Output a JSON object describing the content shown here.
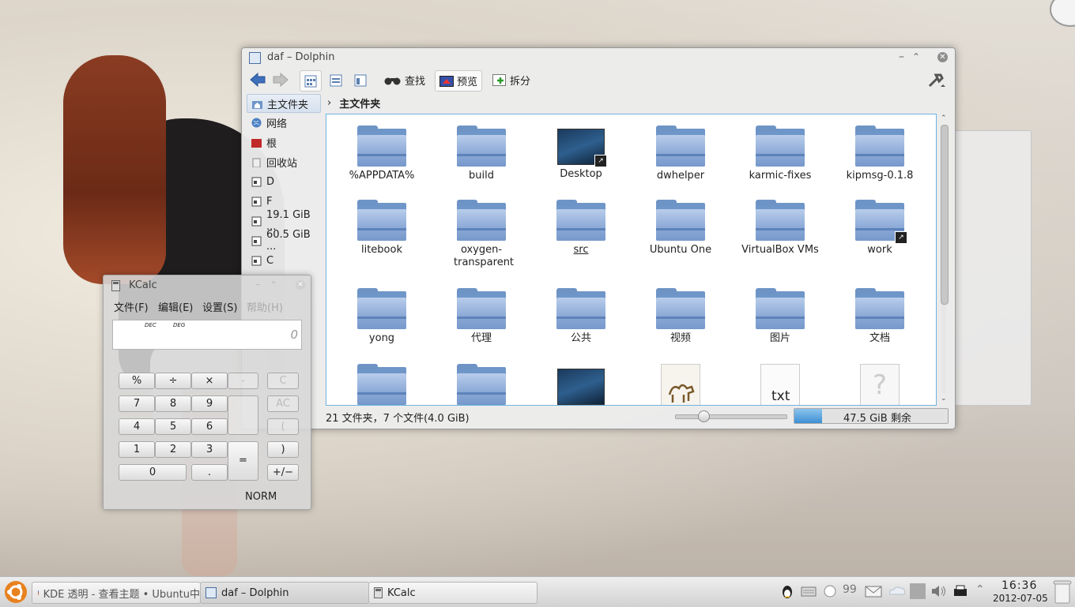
{
  "dolphin": {
    "title": "daf – Dolphin",
    "toolbar": {
      "find": "查找",
      "preview": "预览",
      "split": "拆分"
    },
    "places": [
      "主文件夹",
      "网络",
      "根",
      "回收站",
      "D",
      "F",
      "19.1 GiB ...",
      "60.5 GiB ...",
      "C"
    ],
    "breadcrumb": "主文件夹",
    "items": [
      {
        "label": "%APPDATA%",
        "kind": "folder"
      },
      {
        "label": "build",
        "kind": "folder"
      },
      {
        "label": "Desktop",
        "kind": "desktop-link"
      },
      {
        "label": "dwhelper",
        "kind": "folder"
      },
      {
        "label": "karmic-fixes",
        "kind": "folder"
      },
      {
        "label": "kipmsg-0.1.8",
        "kind": "folder"
      },
      {
        "label": "litebook",
        "kind": "folder"
      },
      {
        "label": "oxygen-transparent",
        "kind": "folder"
      },
      {
        "label": "src",
        "kind": "folder"
      },
      {
        "label": "Ubuntu One",
        "kind": "folder"
      },
      {
        "label": "VirtualBox VMs",
        "kind": "folder"
      },
      {
        "label": "work",
        "kind": "folder-link"
      },
      {
        "label": "yong",
        "kind": "folder"
      },
      {
        "label": "代理",
        "kind": "folder"
      },
      {
        "label": "公共",
        "kind": "folder"
      },
      {
        "label": "视频",
        "kind": "folder"
      },
      {
        "label": "图片",
        "kind": "folder"
      },
      {
        "label": "文档",
        "kind": "folder"
      }
    ],
    "partial_row_icons": [
      "folder",
      "folder",
      "desktop",
      "image",
      "txt",
      "unknown"
    ],
    "txt_label": "txt",
    "status": "21 文件夹，7 个文件(4.0 GiB)",
    "free_space": "47.5 GiB 剩余",
    "free_space_fill": 0.18
  },
  "kcalc": {
    "title": "KCalc",
    "menu": [
      "文件(F)",
      "编辑(E)",
      "设置(S)",
      "帮助(H)"
    ],
    "display_dec": "DEC",
    "display_deg": "DEG",
    "display_value": "0",
    "keys": {
      "percent": "%",
      "divide": "÷",
      "multiply": "×",
      "minus": "-",
      "clear": "C",
      "k7": "7",
      "k8": "8",
      "k9": "9",
      "allclear": "AC",
      "k4": "4",
      "k5": "5",
      "k6": "6",
      "paren_open": "(",
      "k1": "1",
      "k2": "2",
      "k3": "3",
      "equals": "=",
      "paren_close": ")",
      "k0": "0",
      "dot": ".",
      "plusminus": "+/−"
    },
    "mode": "NORM"
  },
  "taskbar": {
    "tasks": [
      "KDE 透明 - 查看主题 • Ubuntu中",
      "daf – Dolphin",
      "KCalc"
    ],
    "time": "16:36",
    "date": "2012-07-05"
  }
}
